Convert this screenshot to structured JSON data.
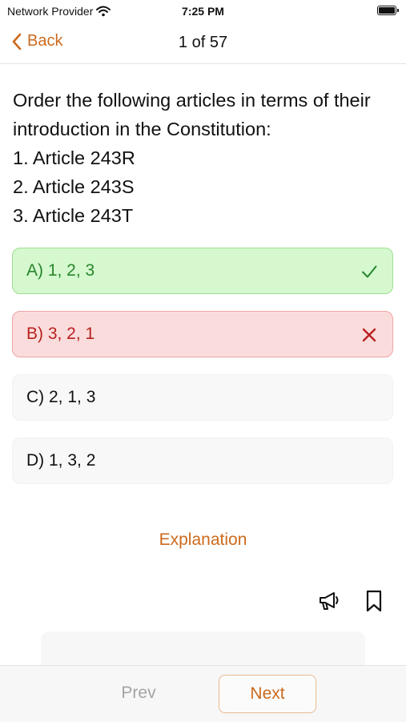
{
  "status_bar": {
    "carrier": "Network Provider",
    "time": "7:25 PM",
    "icons": [
      "wifi-icon",
      "battery-icon"
    ]
  },
  "nav": {
    "back_label": "Back",
    "title": "1 of 57"
  },
  "question": {
    "lines": [
      "Order the following articles in terms of their introduction in the Constitution:",
      "1. Article 243R",
      "2. Article 243S",
      "3. Article 243T"
    ]
  },
  "options": [
    {
      "label": "A) 1, 2, 3",
      "state": "correct",
      "icon": "checkmark-icon"
    },
    {
      "label": "B) 3, 2, 1",
      "state": "incorrect",
      "icon": "cross-icon"
    },
    {
      "label": "C) 2, 1, 3",
      "state": "neutral"
    },
    {
      "label": "D) 1, 3, 2",
      "state": "neutral"
    }
  ],
  "explanation_label": "Explanation",
  "actions": {
    "report_icon": "megaphone-icon",
    "bookmark_icon": "bookmark-icon"
  },
  "footer": {
    "prev_label": "Prev",
    "next_label": "Next"
  },
  "colors": {
    "accent": "#cc6a1d",
    "correct_bg": "#d5f8cf",
    "correct_text": "#27862b",
    "incorrect_bg": "#fbdcdc",
    "incorrect_text": "#b8201e"
  }
}
